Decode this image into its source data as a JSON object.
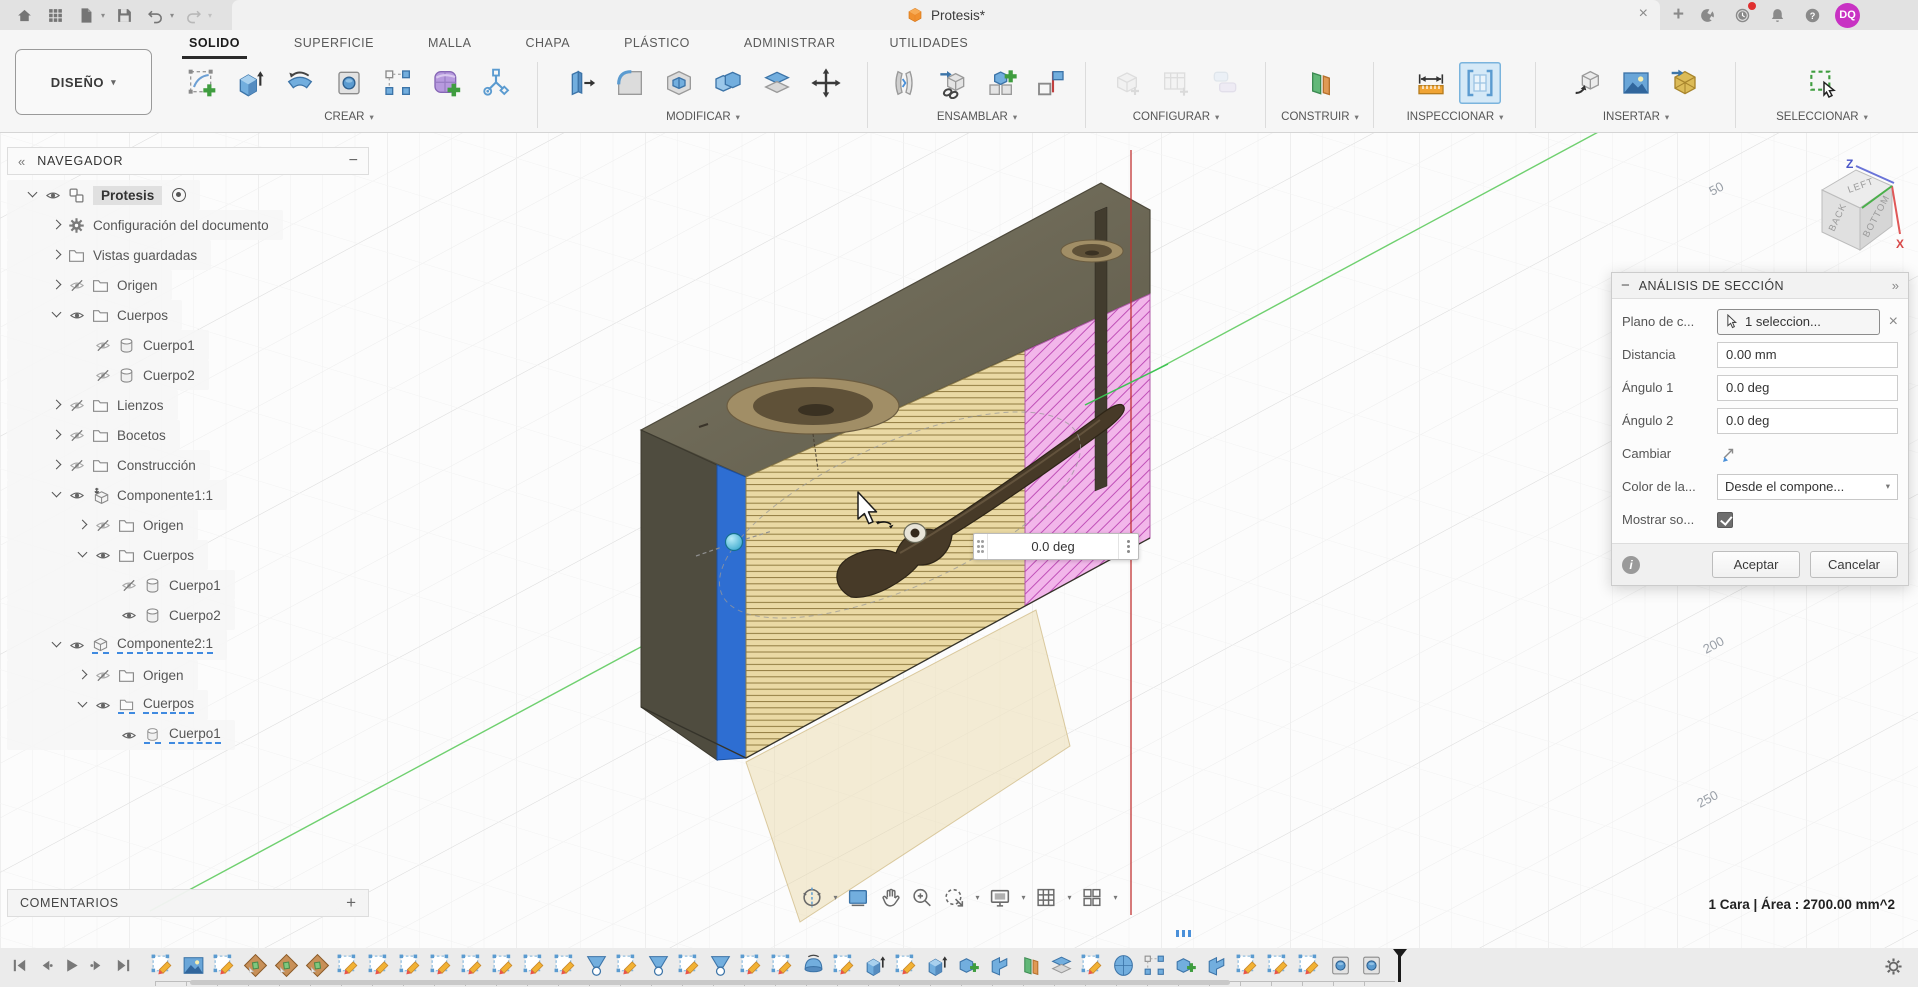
{
  "titlebar": {
    "title": "Protesis*",
    "doc_icon_color": "#f0912f",
    "left_icons": [
      "home-icon",
      "app-grid-icon",
      "file-new-icon",
      "save-icon",
      "undo-icon",
      "redo-icon"
    ],
    "right_icons": [
      "close-tab-icon",
      "new-tab-icon",
      "extensions-icon",
      "job-status-icon",
      "notifications-icon",
      "help-icon"
    ],
    "avatar": "DQ",
    "avatar_color": "#c832c3"
  },
  "ribbon": {
    "environment": "DISEÑO",
    "tabs": [
      {
        "label": "SOLIDO",
        "cls": "active"
      },
      {
        "label": "SUPERFICIE"
      },
      {
        "label": "MALLA"
      },
      {
        "label": "CHAPA"
      },
      {
        "label": "PLÁSTICO"
      },
      {
        "label": "ADMINISTRAR"
      },
      {
        "label": "UTILIDADES"
      }
    ],
    "groups": [
      {
        "label": "CREAR",
        "cls": "g0",
        "tools": [
          {
            "name": "create-sketch-icon",
            "sym": "#t-sketchplus"
          },
          {
            "name": "extrude-icon",
            "sym": "#s-extrude"
          },
          {
            "name": "revolve-icon",
            "sym": "#s-revolve"
          },
          {
            "name": "hole-icon",
            "sym": "#t-hole"
          },
          {
            "name": "pattern-icon",
            "sym": "#s-pattern"
          },
          {
            "name": "create-form-icon",
            "sym": "#s-form"
          },
          {
            "name": "generative-study-icon",
            "sym": "#s-generative"
          }
        ]
      },
      {
        "label": "MODIFICAR",
        "cls": "g1",
        "tools": [
          {
            "name": "press-pull-icon",
            "sym": "#s-presspull"
          },
          {
            "name": "fillet-icon",
            "sym": "#s-fillet"
          },
          {
            "name": "shell-icon",
            "sym": "#s-shell"
          },
          {
            "name": "combine-icon",
            "sym": "#s-combine"
          },
          {
            "name": "split-body-icon",
            "sym": "#s-split"
          },
          {
            "name": "move-copy-icon",
            "sym": "#s-move"
          }
        ]
      },
      {
        "label": "ENSAMBLAR",
        "cls": "g2",
        "tools": [
          {
            "name": "joint-icon",
            "sym": "#s-joint"
          },
          {
            "name": "insert-design-icon",
            "sym": "#s-insertlink"
          },
          {
            "name": "new-component-icon",
            "sym": "#s-newcomp"
          },
          {
            "name": "ground-icon",
            "sym": "#s-ground"
          }
        ]
      },
      {
        "label": "CONFIGURAR",
        "cls": "g3",
        "tools": [
          {
            "name": "configuration-icon",
            "sym": "#s-confcube",
            "cls": "disabled"
          },
          {
            "name": "configuration-table-icon",
            "sym": "#s-conftable",
            "cls": "disabled"
          },
          {
            "name": "configuration-blocks-icon",
            "sym": "#s-confblocks",
            "cls": "disabled"
          }
        ]
      },
      {
        "label": "CONSTRUIR",
        "cls": "g4",
        "tools": [
          {
            "name": "construction-plane-icon",
            "sym": "#s-plane"
          }
        ]
      },
      {
        "label": "INSPECCIONAR",
        "cls": "g5",
        "tools": [
          {
            "name": "measure-icon",
            "sym": "#s-measure"
          },
          {
            "name": "section-analysis-icon",
            "sym": "#s-section",
            "cls": "active"
          }
        ]
      },
      {
        "label": "INSERTAR",
        "cls": "g6",
        "tools": [
          {
            "name": "derive-icon",
            "sym": "#s-derive"
          },
          {
            "name": "canvas-icon",
            "sym": "#s-canvas"
          },
          {
            "name": "insert-mesh-icon",
            "sym": "#s-mesh"
          }
        ]
      },
      {
        "label": "SELECCIONAR",
        "cls": "g7",
        "tools": [
          {
            "name": "select-icon",
            "sym": "#s-select"
          }
        ]
      }
    ]
  },
  "navigator": {
    "header": "NAVEGADOR",
    "comments": "COMENTARIOS",
    "rows": [
      {
        "cls": "lvl0 exp-open sel",
        "eye": "#nv-eye",
        "icon": "#nv-assembly",
        "label": "Protesis"
      },
      {
        "cls": "lvl1 exp-closed noeye",
        "icon": "#nv-gear",
        "label": "Configuración del documento"
      },
      {
        "cls": "lvl1 exp-closed noeye",
        "icon": "#nv-folder",
        "label": "Vistas guardadas"
      },
      {
        "cls": "lvl1 exp-closed",
        "eye": "#nv-eyeoff",
        "icon": "#nv-folder",
        "label": "Origen"
      },
      {
        "cls": "lvl1 exp-open",
        "eye": "#nv-eye",
        "icon": "#nv-folder",
        "label": "Cuerpos"
      },
      {
        "cls": "lvl2 noexp",
        "eye": "#nv-eyeoff",
        "icon": "#nv-body",
        "label": "Cuerpo1"
      },
      {
        "cls": "lvl2 noexp",
        "eye": "#nv-eyeoff",
        "icon": "#nv-body",
        "label": "Cuerpo2"
      },
      {
        "cls": "lvl1 exp-closed",
        "eye": "#nv-eyeoff",
        "icon": "#nv-folder",
        "label": "Lienzos"
      },
      {
        "cls": "lvl1 exp-closed",
        "eye": "#nv-eyeoff",
        "icon": "#nv-folder",
        "label": "Bocetos"
      },
      {
        "cls": "lvl1 exp-closed",
        "eye": "#nv-eyeoff",
        "icon": "#nv-folder",
        "label": "Construcción"
      },
      {
        "cls": "lvl1 exp-open",
        "eye": "#nv-eye",
        "icon": "#nv-anchorcomp",
        "label": "Componente1:1"
      },
      {
        "cls": "lvl2 exp-closed",
        "eye": "#nv-eyeoff",
        "icon": "#nv-folder",
        "label": "Origen"
      },
      {
        "cls": "lvl2 exp-open",
        "eye": "#nv-eye",
        "icon": "#nv-folder",
        "label": "Cuerpos"
      },
      {
        "cls": "lvl3 noexp",
        "eye": "#nv-eyeoff",
        "icon": "#nv-body",
        "label": "Cuerpo1"
      },
      {
        "cls": "lvl3 noexp",
        "eye": "#nv-eye",
        "icon": "#nv-body",
        "label": "Cuerpo2"
      },
      {
        "cls": "lvl1 exp-open dashed",
        "eye": "#nv-eye",
        "icon": "#nv-comp",
        "label": "Componente2:1"
      },
      {
        "cls": "lvl2 exp-closed",
        "eye": "#nv-eyeoff",
        "icon": "#nv-folder",
        "label": "Origen"
      },
      {
        "cls": "lvl2 exp-open dashed",
        "eye": "#nv-eye",
        "icon": "#nv-folder",
        "label": "Cuerpos"
      },
      {
        "cls": "lvl3 noexp dashed",
        "eye": "#nv-eye",
        "icon": "#nv-body",
        "label": "Cuerpo1"
      }
    ]
  },
  "dialog": {
    "title": "ANÁLISIS DE SECCIÓN",
    "plane_label": "Plano de c...",
    "plane_value": "1 seleccion...",
    "distance_label": "Distancia",
    "distance_value": "0.00 mm",
    "angle1_label": "Ángulo 1",
    "angle1_value": "0.0 deg",
    "angle2_label": "Ángulo 2",
    "angle2_value": "0.0 deg",
    "flip_label": "Cambiar",
    "color_label": "Color de la...",
    "color_value": "Desde el compone...",
    "show_label": "Mostrar so...",
    "show_checked": true,
    "ok": "Aceptar",
    "cancel": "Cancelar"
  },
  "viewport": {
    "angle_input": "0.0 deg",
    "grid_labels": [
      "50",
      "200",
      "250"
    ],
    "status": "1 Cara | Área : 2700.00 mm^2",
    "viewcube": {
      "top": "LEFT",
      "left": "BACK",
      "right": "BOTTOM",
      "z": "Z",
      "x": "X"
    },
    "nav_icons": [
      "orbit-icon",
      "look-at-icon",
      "pan-icon",
      "zoom-icon",
      "fit-icon",
      "display-settings-icon",
      "grid-settings-icon",
      "viewports-icon"
    ]
  },
  "timeline": {
    "playback": [
      "go-to-start",
      "step-back",
      "play",
      "step-forward",
      "go-to-end"
    ],
    "features": [
      {
        "name": "sketch-feature-icon",
        "sym": "#t-sketch"
      },
      {
        "name": "canvas-feature-icon",
        "sym": "#s-canvas"
      },
      {
        "name": "sketch-feature-icon",
        "sym": "#t-sketch"
      },
      {
        "name": "decal-feature-icon",
        "sym": "#t-decal"
      },
      {
        "name": "decal-feature-icon",
        "sym": "#t-decal"
      },
      {
        "name": "decal-feature-icon",
        "sym": "#t-decal"
      },
      {
        "name": "sketch-feature-icon",
        "sym": "#t-sketch"
      },
      {
        "name": "sketch-feature-icon",
        "sym": "#t-sketch"
      },
      {
        "name": "sketch-feature-icon",
        "sym": "#t-sketch"
      },
      {
        "name": "sketch-feature-icon",
        "sym": "#t-sketch"
      },
      {
        "name": "sketch-feature-icon",
        "sym": "#t-sketch"
      },
      {
        "name": "sketch-feature-icon",
        "sym": "#t-sketch"
      },
      {
        "name": "sketch-feature-icon",
        "sym": "#t-sketch"
      },
      {
        "name": "sketch-feature-icon",
        "sym": "#t-sketch"
      },
      {
        "name": "loft-feature-icon",
        "sym": "#t-loft"
      },
      {
        "name": "sketch-feature-icon",
        "sym": "#t-sketch"
      },
      {
        "name": "loft-feature-icon",
        "sym": "#t-loft"
      },
      {
        "name": "sketch-feature-icon",
        "sym": "#t-sketch"
      },
      {
        "name": "loft-feature-icon",
        "sym": "#t-loft"
      },
      {
        "name": "sketch-feature-icon",
        "sym": "#t-sketch"
      },
      {
        "name": "sketch-feature-icon",
        "sym": "#t-sketch"
      },
      {
        "name": "revolve-feature-icon",
        "sym": "#t-revolve"
      },
      {
        "name": "sketch-feature-icon",
        "sym": "#t-sketch"
      },
      {
        "name": "extrude-feature-icon",
        "sym": "#s-extrude"
      },
      {
        "name": "sketch-feature-icon",
        "sym": "#t-sketch"
      },
      {
        "name": "extrude-feature-icon",
        "sym": "#s-extrude"
      },
      {
        "name": "combine-feature-icon",
        "sym": "#t-combine"
      },
      {
        "name": "move-feature-icon",
        "sym": "#t-move"
      },
      {
        "name": "plane-feature-icon",
        "sym": "#s-plane"
      },
      {
        "name": "split-feature-icon",
        "sym": "#s-split"
      },
      {
        "name": "sketch-feature-icon",
        "sym": "#t-sketch"
      },
      {
        "name": "form-feature-icon",
        "sym": "#t-form"
      },
      {
        "name": "pattern-feature-icon",
        "sym": "#s-pattern"
      },
      {
        "name": "combine-feature-icon",
        "sym": "#t-combine"
      },
      {
        "name": "move-feature-icon",
        "sym": "#t-move"
      },
      {
        "name": "sketch-feature-icon",
        "sym": "#t-sketch"
      },
      {
        "name": "sketch-feature-icon",
        "sym": "#t-sketch"
      },
      {
        "name": "sketch-feature-icon",
        "sym": "#t-sketch"
      },
      {
        "name": "hole-feature-icon",
        "sym": "#t-hole"
      },
      {
        "name": "hole-feature-icon",
        "sym": "#t-hole"
      }
    ]
  }
}
